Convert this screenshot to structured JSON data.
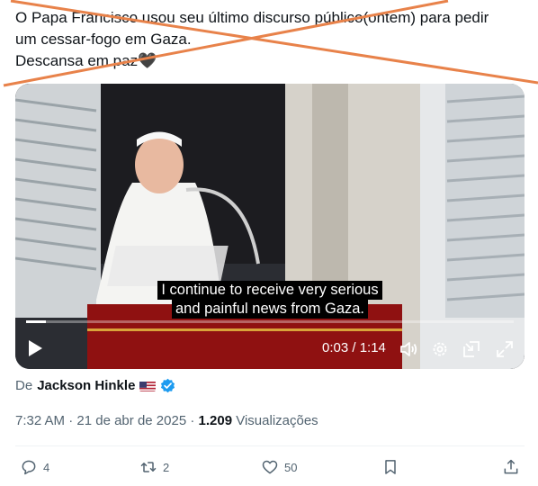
{
  "tweet": {
    "text_line1": "O Papa Francisco usou seu último discurso público(ontem) para pedir",
    "text_line2": "um cessar-fogo em Gaza.",
    "text_line3": "Descansa em paz",
    "heart_emoji": "🖤"
  },
  "video": {
    "subtitle_line1": "I continue to receive very serious",
    "subtitle_line2": "and painful news from Gaza.",
    "time": "0:03 / 1:14",
    "progress": 0.04
  },
  "byline": {
    "prefix": "De",
    "author": "Jackson Hinkle",
    "flag": "us-flag",
    "verified_icon": "verified-badge-icon",
    "verified_color": "#1d9bf0"
  },
  "meta": {
    "time": "7:32 AM",
    "separator": "·",
    "date": "21 de abr de 2025",
    "views_count": "1.209",
    "views_label": "Visualizações"
  },
  "actions": {
    "reply_count": "4",
    "retweet_count": "2",
    "like_count": "50"
  },
  "colors": {
    "cross_out": "#e8824a",
    "muted_text": "#536471"
  }
}
